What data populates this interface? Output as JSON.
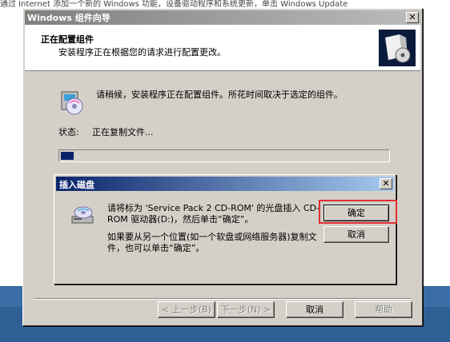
{
  "background": {
    "doc_text": "通过 Internet 添加一个新的 Windows 功能，设备驱动程序和系统更新，单击 Windows Update"
  },
  "wizard": {
    "title": "Windows 组件向导",
    "header_title": "正在配置组件",
    "header_subtitle": "安装程序正在根据您的请求进行配置更改。",
    "message": "请稍候，安装程序正在配置组件。所花时间取决于选定的组件。",
    "status_label": "状态:",
    "status_value": "正在复制文件...",
    "progress_fraction": 0.04,
    "buttons": {
      "back": "< 上一步(B)",
      "next": "下一步(N) >",
      "cancel": "取消",
      "help": "帮助"
    }
  },
  "dialog": {
    "title": "插入磁盘",
    "line1": "请将标为 'Service Pack 2 CD-ROM' 的光盘插入 CD-ROM 驱动器(D:)，然后单击“确定”。",
    "line2": "如果要从另一个位置(如一个软盘或网络服务器)复制文件，也可以单击“确定”。",
    "ok_label": "确定",
    "cancel_label": "取消"
  },
  "colors": {
    "highlight": "#e03030",
    "progress": "#0a246a",
    "desktop": "#3a6ea5"
  }
}
